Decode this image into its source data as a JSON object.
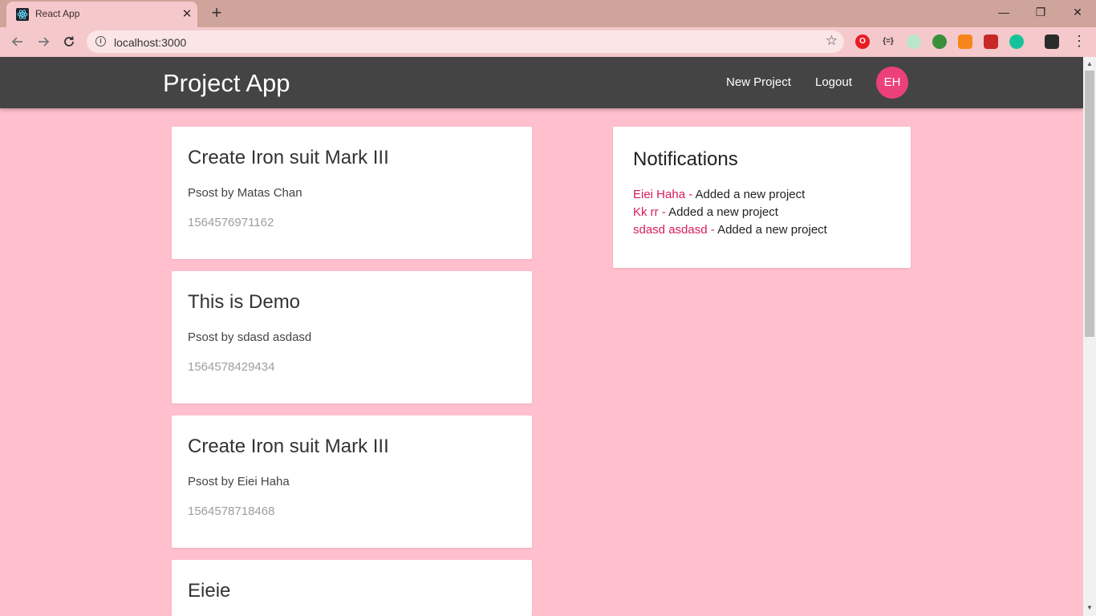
{
  "browser": {
    "tab_title": "React App",
    "url": "localhost:3000",
    "close_glyph": "✕",
    "new_tab_glyph": "+",
    "minimize_glyph": "—",
    "restore_glyph": "❐",
    "window_close_glyph": "✕",
    "extension_glyphs": {
      "json_viewer": "{=}"
    }
  },
  "app": {
    "brand": "Project App",
    "nav": {
      "new_project": "New Project",
      "logout": "Logout",
      "avatar_initials": "EH"
    }
  },
  "projects": [
    {
      "title": "Create Iron suit Mark III",
      "author_line": "Psost by Matas Chan",
      "date": "1564576971162"
    },
    {
      "title": "This is Demo",
      "author_line": "Psost by sdasd asdasd",
      "date": "1564578429434"
    },
    {
      "title": "Create Iron suit Mark III",
      "author_line": "Psost by Eiei Haha",
      "date": "1564578718468"
    },
    {
      "title": "Eieie",
      "author_line": "",
      "date": ""
    }
  ],
  "notifications": {
    "title": "Notifications",
    "items": [
      {
        "user": "Eiei Haha -",
        "content": " Added a new project"
      },
      {
        "user": "Kk rr -",
        "content": " Added a new project"
      },
      {
        "user": "sdasd asdasd -",
        "content": " Added a new project"
      }
    ]
  },
  "colors": {
    "page_background": "#ffbfcd",
    "navbar": "#444444",
    "avatar": "#ec407a",
    "notification_user": "#d81b60",
    "date_text": "#9e9e9e"
  }
}
